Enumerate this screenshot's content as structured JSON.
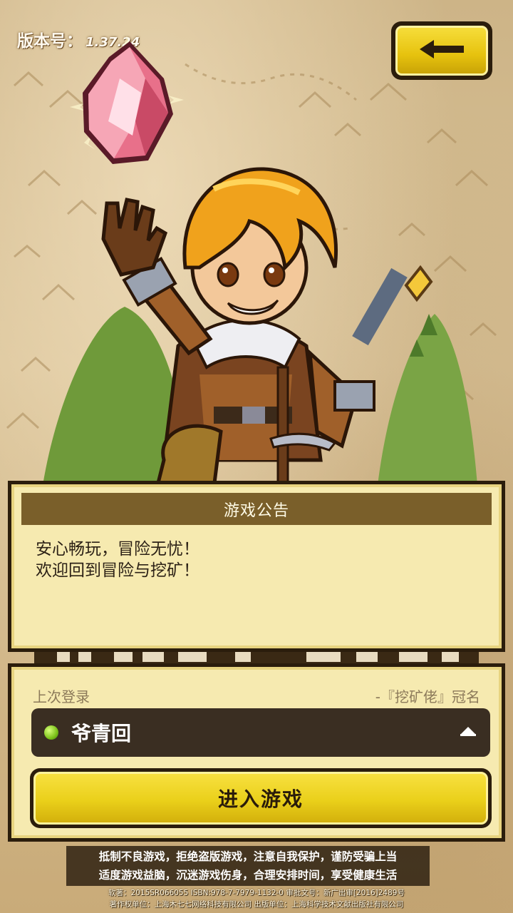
{
  "version": {
    "label": "版本号：",
    "number": "1.37.24"
  },
  "back_button": {
    "icon": "arrow-left-icon"
  },
  "notice": {
    "title": "游戏公告",
    "lines": [
      "安心畅玩，冒险无忧！",
      "欢迎回到冒险与挖矿！"
    ]
  },
  "login": {
    "last_login_label": "上次登录",
    "crown_title": "-『挖矿佬』冠名",
    "server_name": "爷青回",
    "server_status_color": "#7cc21a",
    "dropdown_icon": "chevron-up-icon",
    "enter_button": "进入游戏"
  },
  "health_notice": {
    "line1": "抵制不良游戏，拒绝盗版游戏，注意自我保护，谨防受骗上当",
    "line2": "适度游戏益脑，沉迷游戏伤身，合理安排时间，享受健康生活"
  },
  "legal": {
    "line1": "软著：2015SR066055  ISBN:978-7-7979-1132-0   审批文号：新广出审[2016]2489号",
    "line2": "著作权单位：上海木七七网络科技有限公司    出版单位：上海科学技术文献出版社有限公司"
  },
  "colors": {
    "accent_yellow": "#ead01a",
    "panel_bg": "#f6eab0",
    "dark_border": "#2b1d0c",
    "title_bar": "#7a5f2a"
  }
}
